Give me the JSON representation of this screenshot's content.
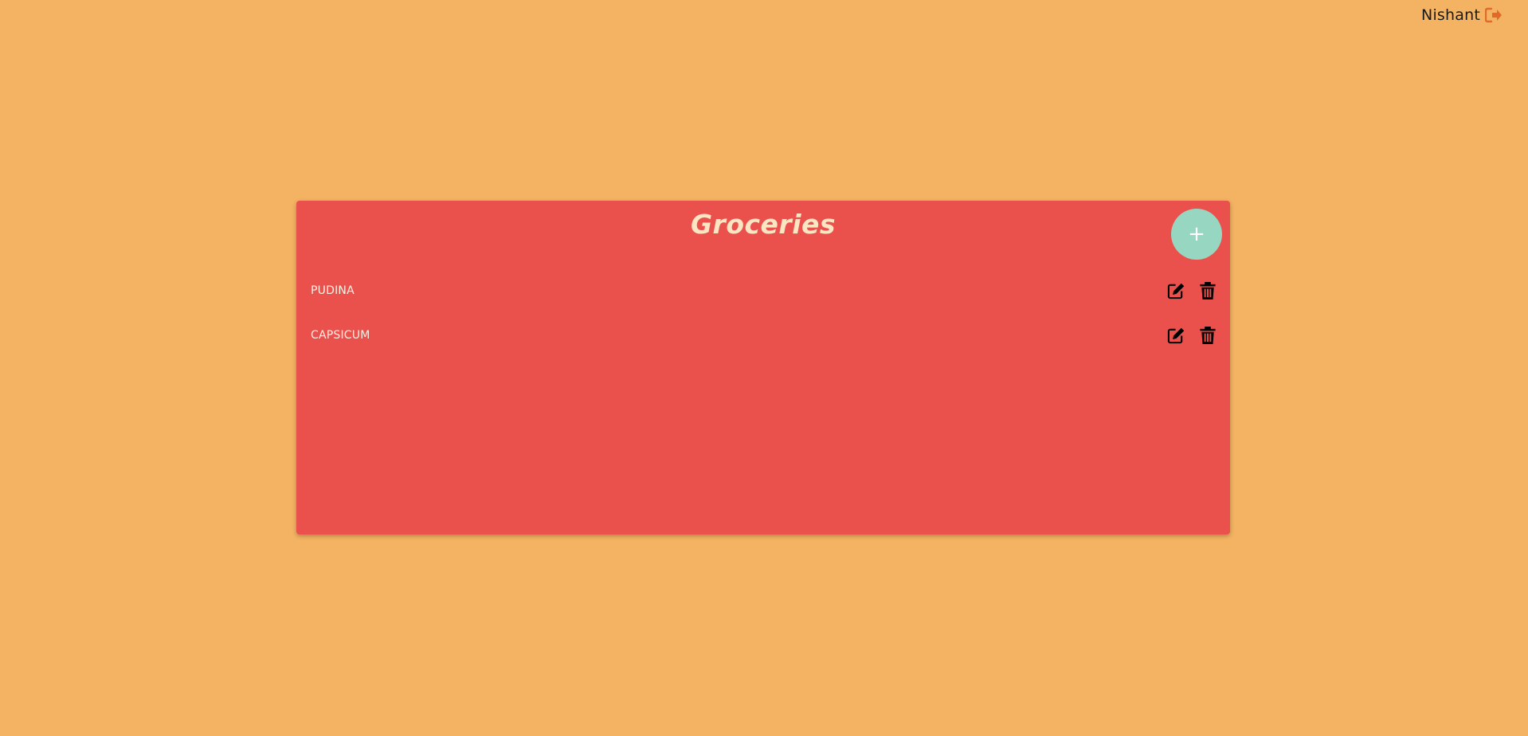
{
  "header": {
    "username": "Nishant",
    "logout_icon": "sign-out-icon",
    "logout_icon_color": "#e06a2a"
  },
  "card": {
    "title": "Groceries",
    "add_label": "+",
    "background": "#eb514c",
    "add_button_color": "#97d7c1",
    "items": [
      {
        "label": "PUDINA",
        "edit_icon": "edit-icon",
        "delete_icon": "trash-icon"
      },
      {
        "label": "CAPSICUM",
        "edit_icon": "edit-icon",
        "delete_icon": "trash-icon"
      }
    ]
  },
  "colors": {
    "page_background": "#f4b362",
    "title_text": "#fbe6c4",
    "item_text": "#fdf1e6"
  }
}
